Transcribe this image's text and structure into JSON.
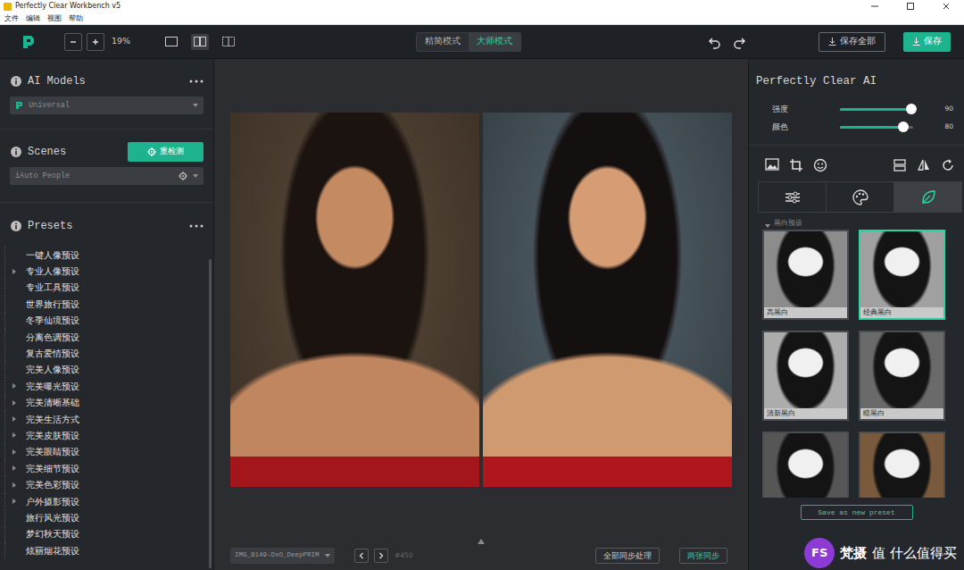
{
  "window": {
    "title": "Perfectly Clear Workbench v5"
  },
  "menu": [
    "文件",
    "编辑",
    "视图",
    "帮助"
  ],
  "toolbar": {
    "zoom": "19%",
    "view_modes": [
      {
        "kind": "single",
        "selected": false
      },
      {
        "kind": "sidebyside",
        "selected": true
      },
      {
        "kind": "split",
        "selected": false
      }
    ],
    "modes": [
      {
        "label": "精简模式",
        "selected": false
      },
      {
        "label": "大师模式",
        "selected": true
      }
    ],
    "save_all": "保存全部",
    "save": "保存"
  },
  "left": {
    "ai_models": {
      "title": "AI Models",
      "value": "Universal"
    },
    "scenes": {
      "title": "Scenes",
      "button": "重检测",
      "value": "iAuto People"
    },
    "presets": {
      "title": "Presets",
      "items": [
        {
          "label": "一键人像预设",
          "expandable": false
        },
        {
          "label": "专业人像预设",
          "expandable": true
        },
        {
          "label": "专业工具预设",
          "expandable": false
        },
        {
          "label": "世界旅行预设",
          "expandable": false
        },
        {
          "label": "冬季仙境预设",
          "expandable": false
        },
        {
          "label": "分离色调预设",
          "expandable": false
        },
        {
          "label": "复古爱情预设",
          "expandable": false
        },
        {
          "label": "完美人像预设",
          "expandable": false
        },
        {
          "label": "完美曝光预设",
          "expandable": true
        },
        {
          "label": "完美清晰基础",
          "expandable": true
        },
        {
          "label": "完美生活方式",
          "expandable": true
        },
        {
          "label": "完美皮肤预设",
          "expandable": true
        },
        {
          "label": "完美眼睛预设",
          "expandable": true
        },
        {
          "label": "完美细节预设",
          "expandable": true
        },
        {
          "label": "完美色彩预设",
          "expandable": true
        },
        {
          "label": "户外摄影预设",
          "expandable": true
        },
        {
          "label": "旅行风光预设",
          "expandable": false
        },
        {
          "label": "梦幻秋天预设",
          "expandable": false
        },
        {
          "label": "炫丽烟花预设",
          "expandable": false
        }
      ]
    }
  },
  "center": {
    "photos": [
      {
        "kind": "before"
      },
      {
        "kind": "after"
      }
    ],
    "file": "IMG_9149-DxO_DeepPRIM",
    "count": "#450",
    "sync_all": "全部同步处理",
    "sync_pair": "两张同步"
  },
  "right": {
    "title": "Perfectly Clear AI",
    "sliders": [
      {
        "label": "强度",
        "level": 0.97,
        "reading": "90"
      },
      {
        "label": "颜色",
        "level": 0.87,
        "reading": "80"
      }
    ],
    "tabs": [
      {
        "kind": "adjust",
        "selected": false
      },
      {
        "kind": "palette",
        "selected": false
      },
      {
        "kind": "leaf",
        "selected": true
      }
    ],
    "section": "黑白预设",
    "thumbnails": [
      {
        "label": "高黑白",
        "selected": false,
        "color": "#8c8c8c"
      },
      {
        "label": "经典黑白",
        "selected": true,
        "color": "#a0a0a0"
      },
      {
        "label": "清新黑白",
        "selected": false,
        "color": "#acacac"
      },
      {
        "label": "暗黑白",
        "selected": false,
        "color": "#6a6a6a"
      },
      {
        "selected": false,
        "color": "#565656"
      },
      {
        "selected": false,
        "color": "#7a5a3c"
      }
    ],
    "save_preset": "Save as new preset"
  },
  "watermark": {
    "logo": "FS",
    "brand": "梵摄",
    "site": "值 什么值得买"
  }
}
